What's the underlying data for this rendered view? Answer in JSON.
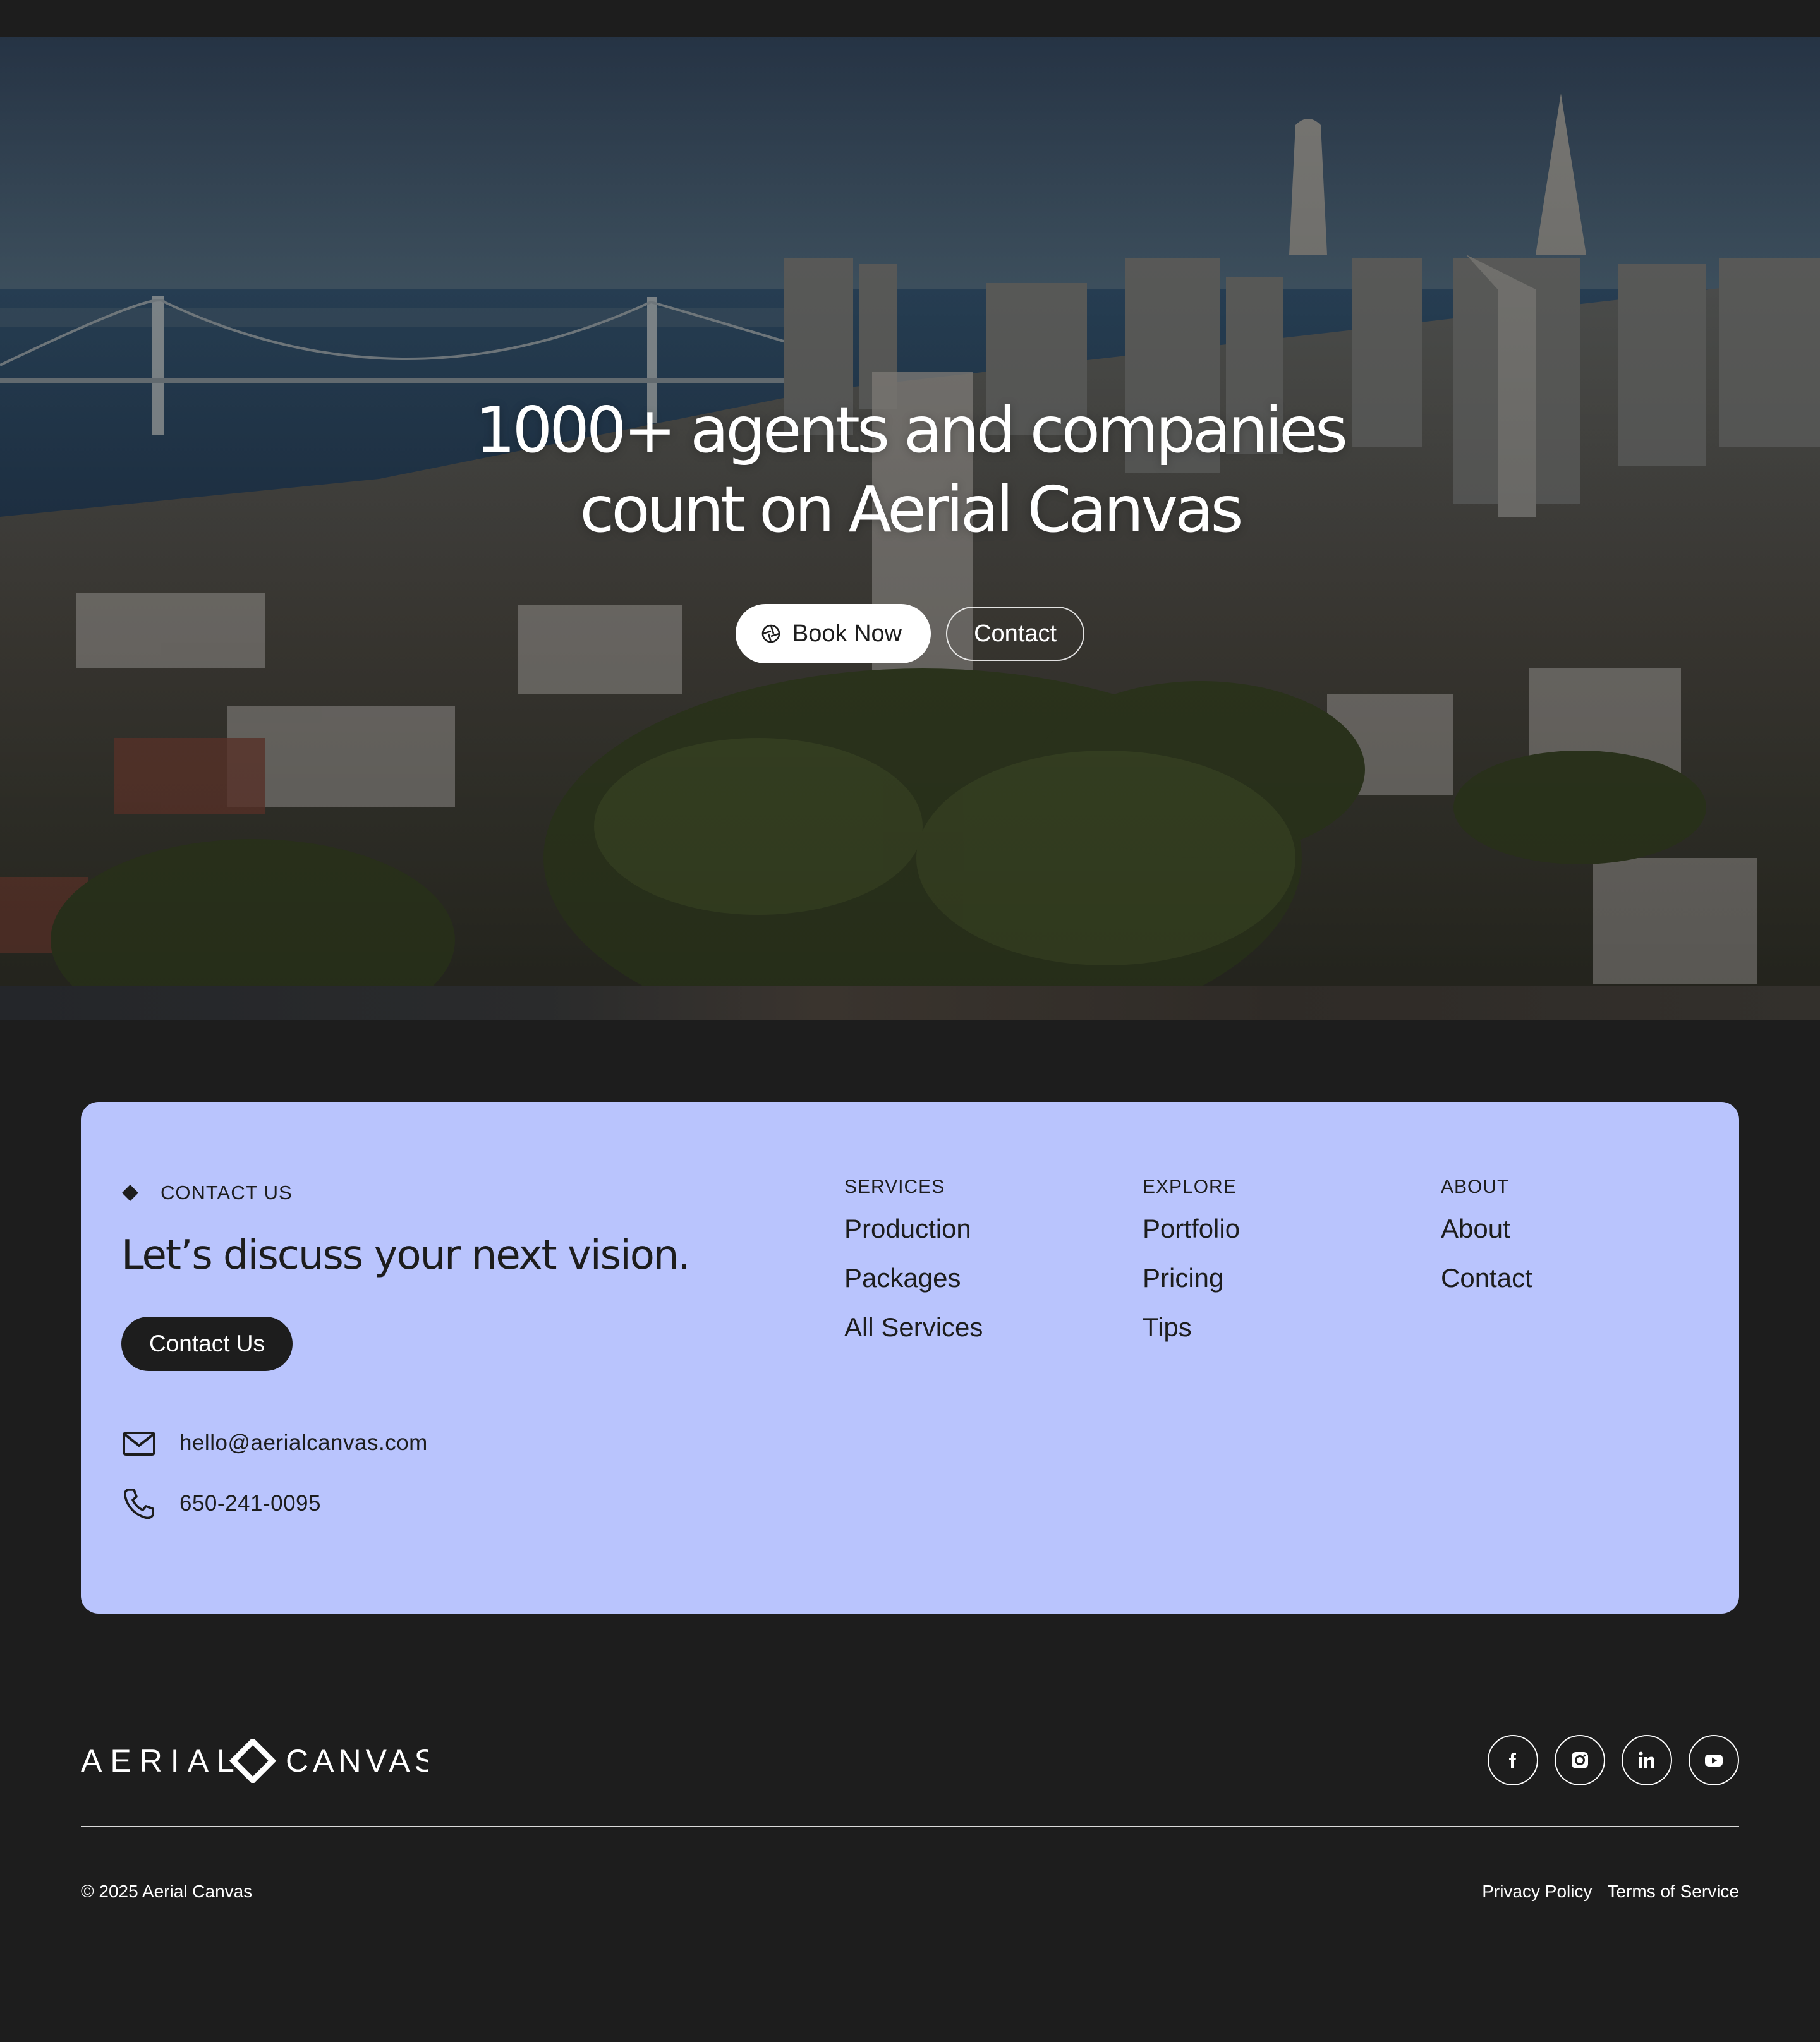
{
  "hero": {
    "title": "1000+ agents and companies count on Aerial Canvas",
    "book_button": "Book Now",
    "contact_button": "Contact"
  },
  "contact_card": {
    "eyebrow": "CONTACT US",
    "heading": "Let’s discuss your next vision.",
    "cta": "Contact Us",
    "email": "hello@aerialcanvas.com",
    "phone": "650-241-0095",
    "background": "#b9c4fd"
  },
  "columns": {
    "services": {
      "title": "SERVICES",
      "links": [
        "Production",
        "Packages",
        "All Services"
      ]
    },
    "explore": {
      "title": "EXPLORE",
      "links": [
        "Portfolio",
        "Pricing",
        "Tips"
      ]
    },
    "about": {
      "title": "ABOUT",
      "links": [
        "About",
        "Contact"
      ]
    }
  },
  "footer": {
    "logo_left": "AERIAL",
    "logo_right": "CANVAS",
    "copyright": "© 2025 Aerial Canvas",
    "privacy": "Privacy Policy",
    "terms": "Terms of Service",
    "socials": [
      "facebook-icon",
      "instagram-icon",
      "linkedin-icon",
      "youtube-icon"
    ],
    "background": "#1d1d1d"
  }
}
